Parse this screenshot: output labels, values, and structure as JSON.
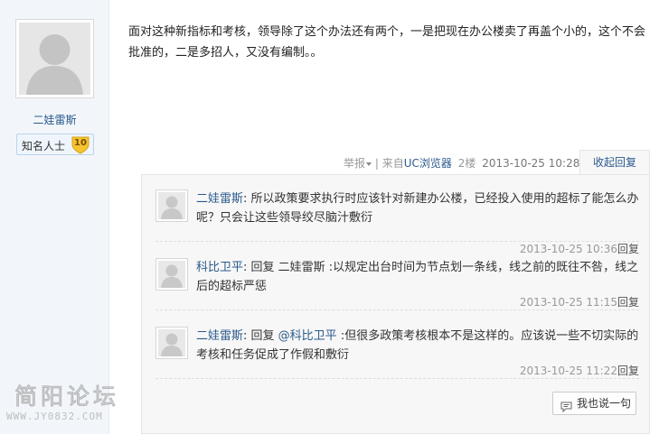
{
  "author": {
    "name": "二娃雷斯",
    "badge_label": "知名人士",
    "badge_level": "10",
    "avatar_icon": "default-avatar-icon"
  },
  "post": {
    "text": "面对这种新指标和考核，领导除了这个办法还有两个，一是把现在办公楼卖了再盖个小的，这个不会批准的，二是多招人，又没有编制。。"
  },
  "meta": {
    "report_label": "举报",
    "separator": "|",
    "source_prefix": "来自",
    "source_name": "UC浏览器",
    "floor": "2楼",
    "datetime": "2013-10-25 10:28",
    "collapse_label": "收起回复"
  },
  "replies": [
    {
      "user": "二娃雷斯",
      "prefix": "",
      "mention": "",
      "content": "所以政策要求执行时应该针对新建办公楼，已经投入使用的超标了能怎么办呢？只会让这些领导绞尽脑汁敷衍",
      "time": "2013-10-25 10:36",
      "reply_label": "回复"
    },
    {
      "user": "科比卫平",
      "prefix": "回复 二娃雷斯 ",
      "mention": "",
      "content": ":以规定出台时间为节点划一条线，线之前的既往不咎，线之后的超标严惩",
      "time": "2013-10-25 11:15",
      "reply_label": "回复"
    },
    {
      "user": "二娃雷斯",
      "prefix": "回复 ",
      "mention": "@科比卫平",
      "content": " :但很多政策考核根本不是这样的。应该说一些不切实际的考核和任务促成了作假和敷衍",
      "time": "2013-10-25 11:22",
      "reply_label": "回复"
    }
  ],
  "say_button": {
    "label": "我也说一句",
    "icon": "comment-icon"
  },
  "watermark": {
    "title": "简阳论坛",
    "url": "WWW.JY0832.COM"
  },
  "colors": {
    "link": "#2b5a8c",
    "author_bg": "#f2f6fb",
    "reply_bg": "#f7f7f7",
    "badge_level": "#f5c431"
  }
}
